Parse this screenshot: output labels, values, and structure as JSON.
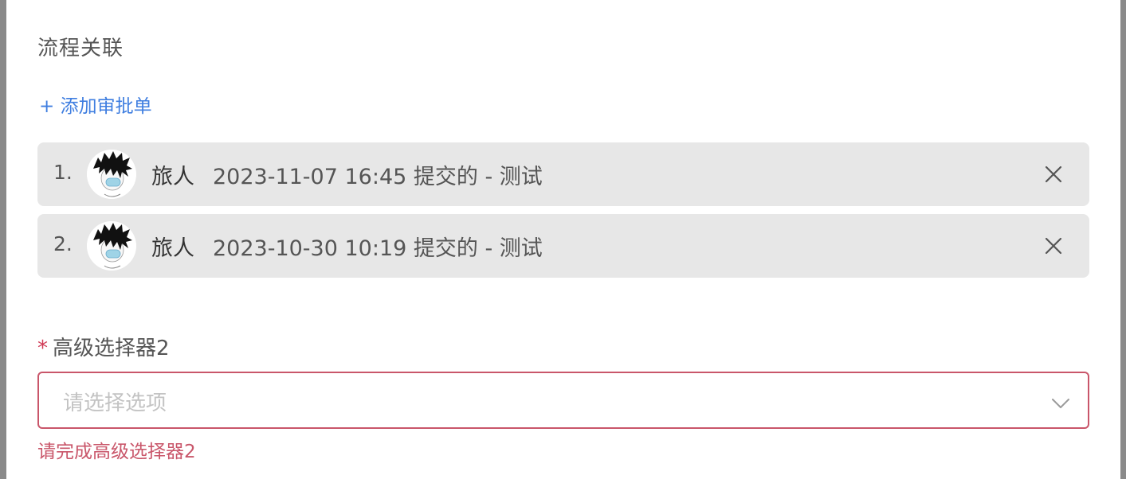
{
  "section": {
    "title": "流程关联",
    "add_link": "+ 添加审批单"
  },
  "approvals": [
    {
      "index": "1.",
      "name": "旅人",
      "desc": "2023-11-07 16:45 提交的 - 测试",
      "close_icon": "close-icon"
    },
    {
      "index": "2.",
      "name": "旅人",
      "desc": "2023-10-30 10:19 提交的 - 测试",
      "close_icon": "close-icon"
    }
  ],
  "field": {
    "required_mark": "*",
    "label": "高级选择器2",
    "placeholder": "请选择选项",
    "icon": "chevron-down-icon",
    "error": "请完成高级选择器2"
  },
  "colors": {
    "link": "#3f7ee0",
    "error": "#c9566a",
    "card_bg": "#e7e7e7"
  }
}
